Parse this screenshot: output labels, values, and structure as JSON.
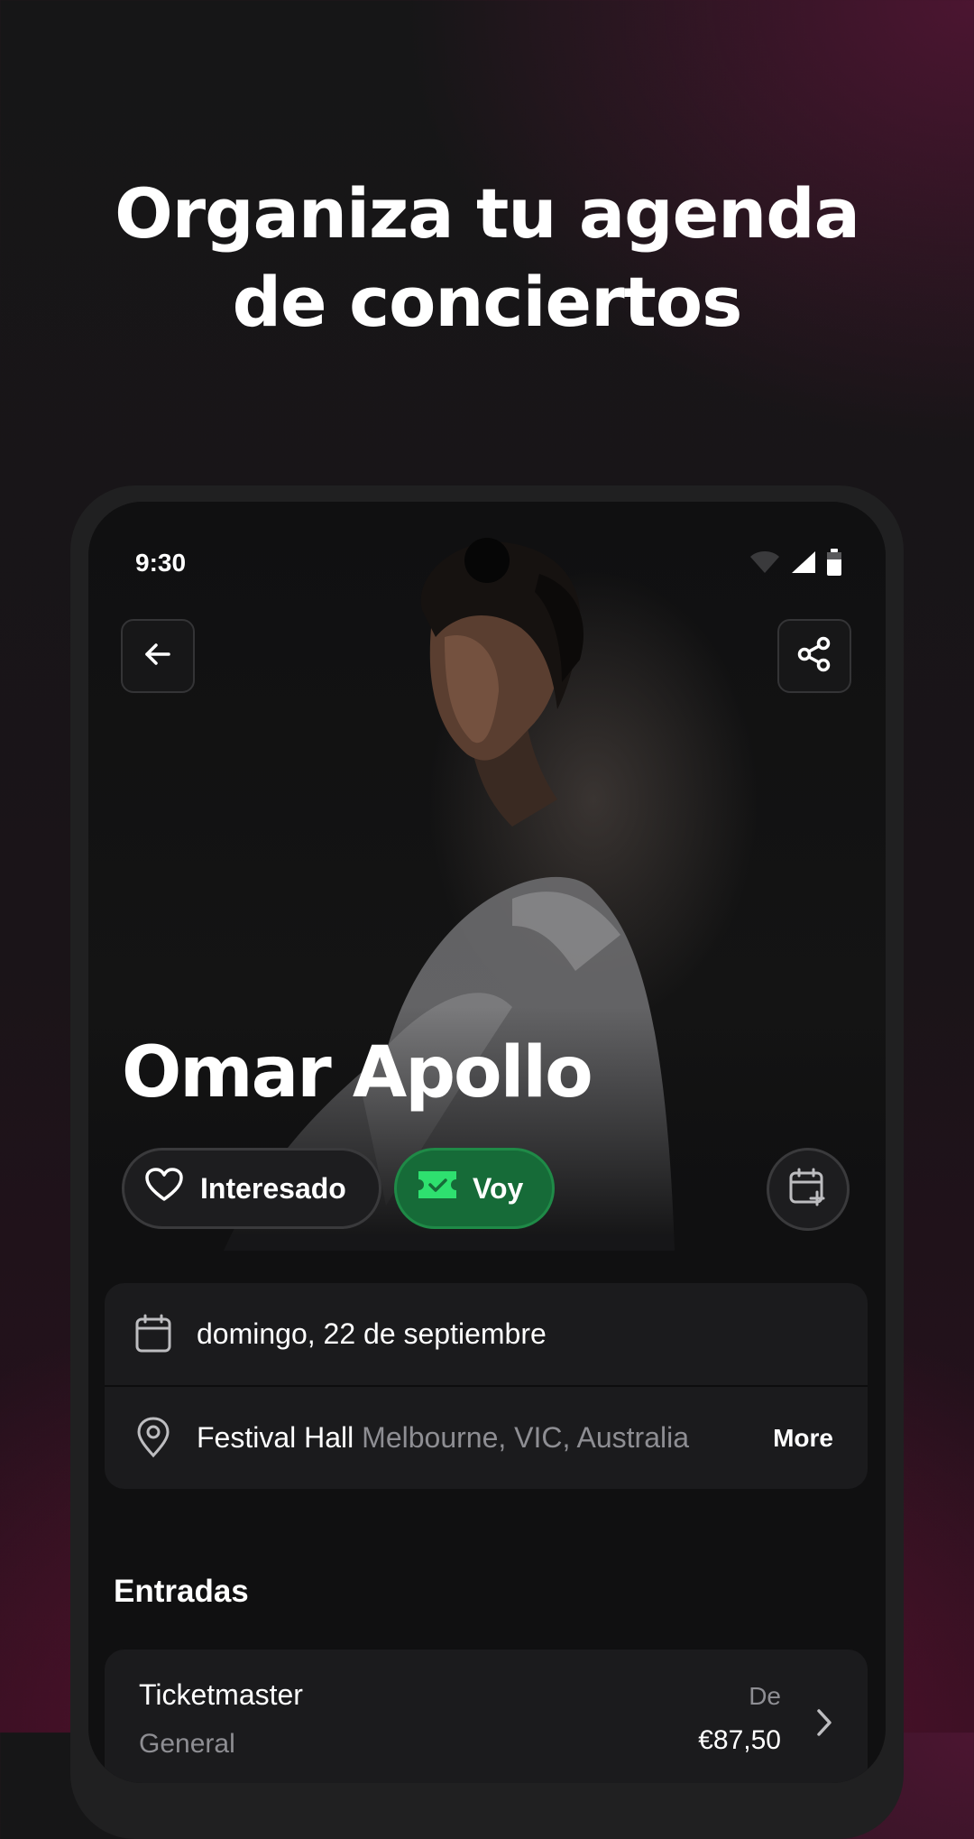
{
  "headline": {
    "line1": "Organiza tu agenda",
    "line2": "de conciertos"
  },
  "status_bar": {
    "time": "9:30",
    "icons": [
      "wifi-icon",
      "signal-icon",
      "battery-icon"
    ]
  },
  "toolbar": {
    "back_icon": "arrow-left-icon",
    "share_icon": "share-icon"
  },
  "event": {
    "artist": "Omar Apollo",
    "interested_label": "Interesado",
    "going_label": "Voy",
    "date": "domingo, 22 de septiembre",
    "venue": "Festival Hall",
    "city": "Melbourne, VIC, Australia",
    "more_label": "More"
  },
  "tickets": {
    "section_title": "Entradas",
    "items": [
      {
        "provider": "Ticketmaster",
        "subtitle": "General",
        "from_label": "De",
        "price": "€87,50"
      }
    ]
  },
  "colors": {
    "going_accent": "#166b38",
    "going_icon": "#2ee06f",
    "card_bg": "#1b1b1d",
    "muted_text": "#8e8e93"
  }
}
